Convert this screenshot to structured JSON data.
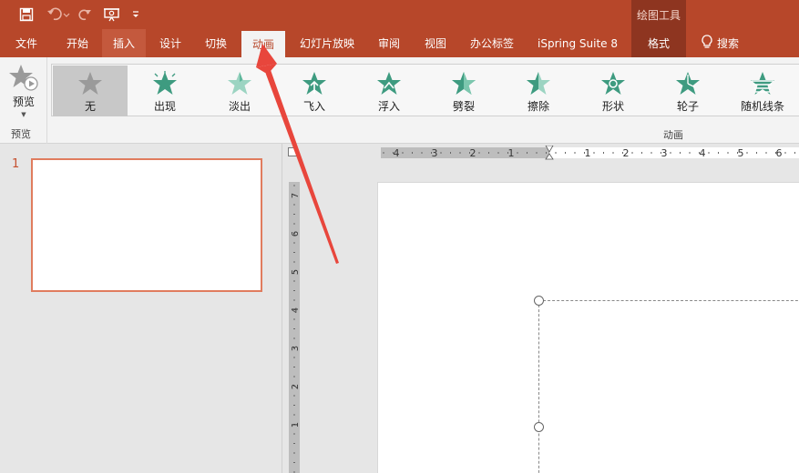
{
  "title_bar": {
    "context_tab_group": "绘图工具",
    "save_icon": "save-icon",
    "undo_icon": "undo-icon",
    "redo_icon": "redo-icon",
    "present_icon": "present-from-start-icon",
    "customize_icon": "customize-quick-access-icon"
  },
  "tabs": [
    "文件",
    "开始",
    "插入",
    "设计",
    "切换",
    "动画",
    "幻灯片放映",
    "审阅",
    "视图",
    "办公标签",
    "iSpring Suite 8",
    "格式"
  ],
  "active_tab": "动画",
  "search": {
    "label": "搜索",
    "icon": "lightbulb-icon"
  },
  "ribbon": {
    "preview_label": "预览",
    "preview_group_label": "预览",
    "animation_group_label": "动画",
    "animations": [
      {
        "label": "无",
        "icon": "star-gray-icon",
        "selected": true
      },
      {
        "label": "出现",
        "icon": "star-burst-icon",
        "selected": false
      },
      {
        "label": "淡出",
        "icon": "star-fade-icon",
        "selected": false
      },
      {
        "label": "飞入",
        "icon": "star-fly-in-icon",
        "selected": false
      },
      {
        "label": "浮入",
        "icon": "star-float-in-icon",
        "selected": false
      },
      {
        "label": "劈裂",
        "icon": "star-split-icon",
        "selected": false
      },
      {
        "label": "擦除",
        "icon": "star-wipe-icon",
        "selected": false
      },
      {
        "label": "形状",
        "icon": "star-shape-icon",
        "selected": false
      },
      {
        "label": "轮子",
        "icon": "star-wheel-icon",
        "selected": false
      },
      {
        "label": "随机线条",
        "icon": "star-random-bars-icon",
        "selected": false
      }
    ]
  },
  "slide_panel": {
    "slide_number": "1"
  },
  "ruler": {
    "horizontal_labels": [
      "4",
      "3",
      "2",
      "1",
      "1",
      "2",
      "3",
      "4",
      "5",
      "6"
    ],
    "vertical_labels": [
      "7",
      "6",
      "5",
      "4",
      "3",
      "2",
      "1"
    ]
  },
  "colors": {
    "accent": "#b7472a",
    "context_tab": "#8e3520",
    "thumb_border": "#e07c5e",
    "annotation_arrow": "#e8463c"
  }
}
